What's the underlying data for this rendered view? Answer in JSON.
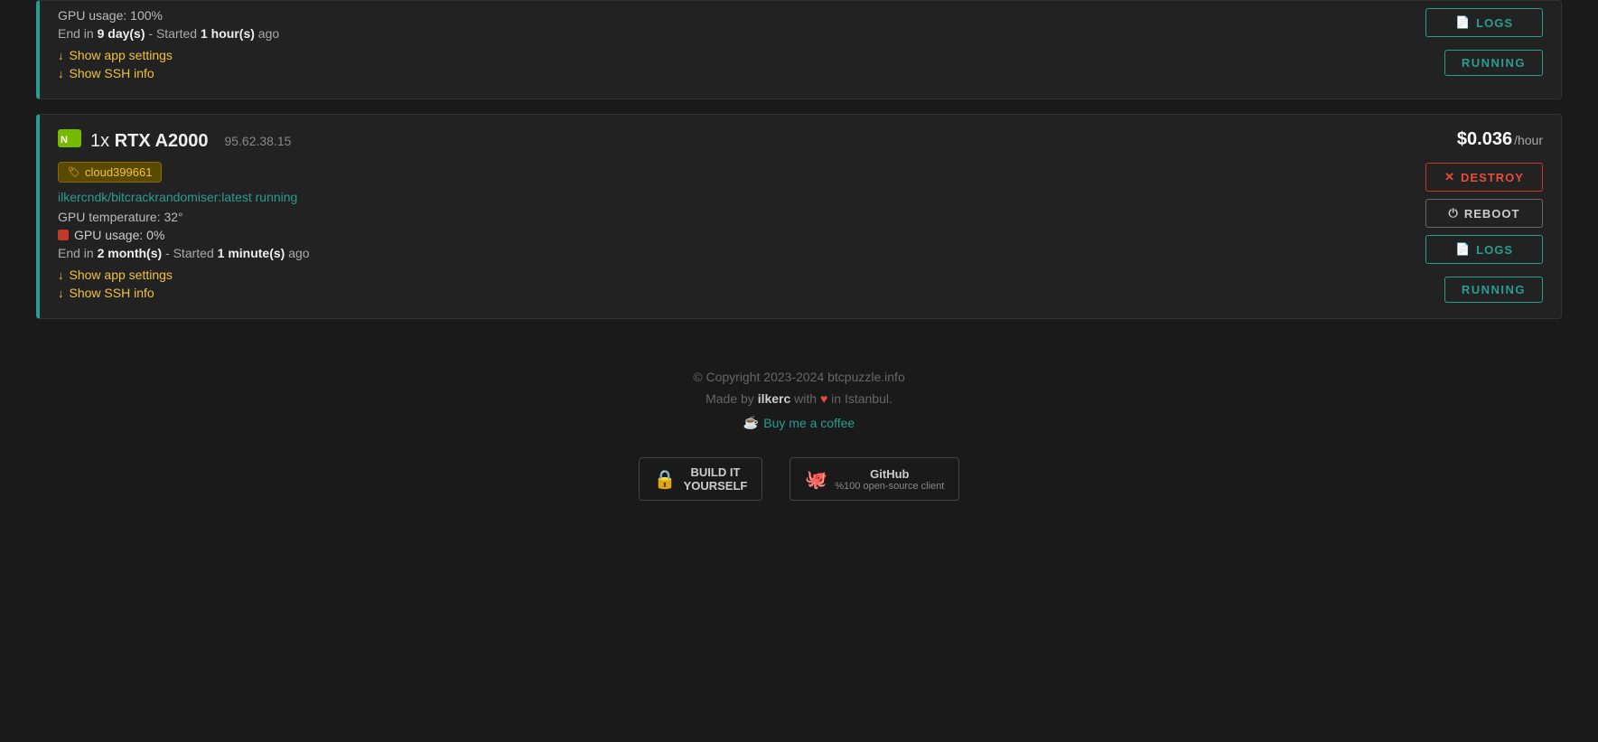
{
  "cards": [
    {
      "id": "card-top-partial",
      "partial": true,
      "gpu_usage_label": "GPU usage: 100%",
      "end_line": "End in",
      "end_bold": "9 day(s)",
      "started_label": "- Started",
      "started_bold": "1 hour(s)",
      "started_suffix": "ago",
      "show_app_settings": "Show app settings",
      "show_ssh_info": "Show SSH info",
      "status": "RUNNING",
      "logs_label": "LOGS",
      "buttons": {
        "logs": "LOGS"
      }
    },
    {
      "id": "card-rtx-a2000",
      "partial": false,
      "quantity": "1x",
      "gpu_name": "RTX A2000",
      "ip": "95.62.38.15",
      "price": "$0.036",
      "price_unit": "/hour",
      "tag": "cloud399661",
      "container": "ilkercndk/bitcrackrandomiser:latest running",
      "gpu_temp": "GPU temperature: 32°",
      "gpu_usage_label": "GPU usage: 0%",
      "gpu_usage_color": "red",
      "end_line": "End in",
      "end_bold": "2 month(s)",
      "started_label": "- Started",
      "started_bold": "1 minute(s)",
      "started_suffix": "ago",
      "show_app_settings": "Show app settings",
      "show_ssh_info": "Show SSH info",
      "status": "RUNNING",
      "buttons": {
        "destroy": "DESTROY",
        "reboot": "REBOOT",
        "logs": "LOGS"
      }
    }
  ],
  "footer": {
    "copyright": "© Copyright 2023-2024 btcpuzzle.info",
    "made_by_prefix": "Made by",
    "made_by_name": "ilkerc",
    "made_by_middle": "with",
    "made_by_suffix": "in Istanbul.",
    "coffee_label": "Buy me a coffee",
    "logo1_line1": "BUILD IT",
    "logo1_line2": "YOURSELF",
    "logo2_label": "GitHub",
    "logo2_sub": "%100 open-source client"
  }
}
